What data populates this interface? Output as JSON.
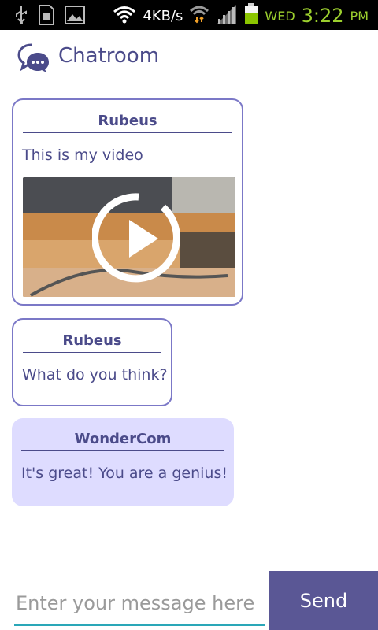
{
  "status_bar": {
    "speed": "4KB/s",
    "day": "WED",
    "time": "3:22",
    "ampm": "PM",
    "icons": [
      "usb-icon",
      "sd-card-icon",
      "image-icon",
      "wifi-icon",
      "wifi-transfer-icon",
      "signal-icon",
      "battery-icon"
    ]
  },
  "header": {
    "title": "Chatroom",
    "icon": "chat-bubbles-icon"
  },
  "messages": [
    {
      "sender": "Rubeus",
      "text": "This is my video",
      "has_video": true
    },
    {
      "sender": "Rubeus",
      "text": "What do you think?"
    },
    {
      "sender": "WonderCom",
      "text": "It's great! You are a genius!"
    }
  ],
  "composer": {
    "placeholder": "Enter your message here",
    "value": "",
    "send_label": "Send"
  },
  "colors": {
    "accent": "#4b4b8a",
    "outgoing_border": "#7b78c7",
    "incoming_bg": "#dedcff",
    "send_button": "#5a5795",
    "underline": "#2aa7b8"
  }
}
